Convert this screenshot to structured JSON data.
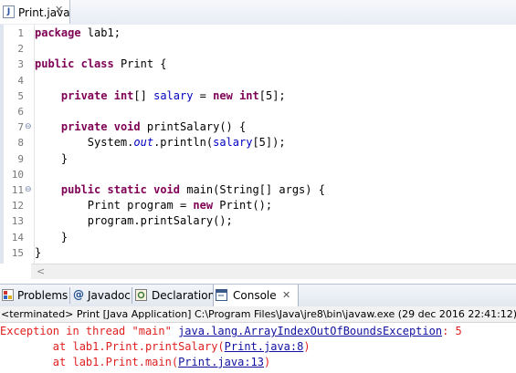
{
  "editor": {
    "tab_label": "Print.java",
    "tab_close": "✕",
    "file_icon_letter": "J",
    "lines": [
      {
        "num": "1",
        "fold": "",
        "parts": [
          {
            "t": "package",
            "c": "kw"
          },
          {
            "t": " lab1;",
            "c": ""
          }
        ]
      },
      {
        "num": "2",
        "fold": "",
        "parts": []
      },
      {
        "num": "3",
        "fold": "",
        "parts": [
          {
            "t": "public",
            "c": "kw"
          },
          {
            "t": " ",
            "c": ""
          },
          {
            "t": "class",
            "c": "kw"
          },
          {
            "t": " Print {",
            "c": ""
          }
        ]
      },
      {
        "num": "4",
        "fold": "",
        "parts": []
      },
      {
        "num": "5",
        "fold": "",
        "parts": [
          {
            "t": "    ",
            "c": ""
          },
          {
            "t": "private",
            "c": "kw"
          },
          {
            "t": " ",
            "c": ""
          },
          {
            "t": "int",
            "c": "kw"
          },
          {
            "t": "[] ",
            "c": ""
          },
          {
            "t": "salary",
            "c": "fld"
          },
          {
            "t": " = ",
            "c": ""
          },
          {
            "t": "new",
            "c": "kw"
          },
          {
            "t": " ",
            "c": ""
          },
          {
            "t": "int",
            "c": "kw"
          },
          {
            "t": "[5];",
            "c": ""
          }
        ]
      },
      {
        "num": "6",
        "fold": "",
        "parts": []
      },
      {
        "num": "7",
        "fold": "⊖",
        "parts": [
          {
            "t": "    ",
            "c": ""
          },
          {
            "t": "private",
            "c": "kw"
          },
          {
            "t": " ",
            "c": ""
          },
          {
            "t": "void",
            "c": "kw"
          },
          {
            "t": " printSalary() {",
            "c": ""
          }
        ]
      },
      {
        "num": "8",
        "fold": "",
        "parts": [
          {
            "t": "        System.",
            "c": ""
          },
          {
            "t": "out",
            "c": "sfld"
          },
          {
            "t": ".println(",
            "c": ""
          },
          {
            "t": "salary",
            "c": "fld"
          },
          {
            "t": "[5]);",
            "c": ""
          }
        ]
      },
      {
        "num": "9",
        "fold": "",
        "parts": [
          {
            "t": "    }",
            "c": ""
          }
        ]
      },
      {
        "num": "10",
        "fold": "",
        "parts": []
      },
      {
        "num": "11",
        "fold": "⊖",
        "parts": [
          {
            "t": "    ",
            "c": ""
          },
          {
            "t": "public",
            "c": "kw"
          },
          {
            "t": " ",
            "c": ""
          },
          {
            "t": "static",
            "c": "kw"
          },
          {
            "t": " ",
            "c": ""
          },
          {
            "t": "void",
            "c": "kw"
          },
          {
            "t": " main(String[] args) {",
            "c": ""
          }
        ]
      },
      {
        "num": "12",
        "fold": "",
        "parts": [
          {
            "t": "        Print program = ",
            "c": ""
          },
          {
            "t": "new",
            "c": "kw"
          },
          {
            "t": " Print();",
            "c": ""
          }
        ]
      },
      {
        "num": "13",
        "fold": "",
        "parts": [
          {
            "t": "        program.printSalary();",
            "c": ""
          }
        ]
      },
      {
        "num": "14",
        "fold": "",
        "parts": [
          {
            "t": "    }",
            "c": ""
          }
        ]
      },
      {
        "num": "15",
        "fold": "",
        "parts": [
          {
            "t": "}",
            "c": ""
          }
        ]
      }
    ],
    "scroll_left": "<"
  },
  "panel": {
    "tabs": [
      {
        "label": "Problems",
        "icon": "problems-icon"
      },
      {
        "label": "Javadoc",
        "icon": "javadoc-icon"
      },
      {
        "label": "Declaration",
        "icon": "declaration-icon"
      },
      {
        "label": "Console",
        "icon": "console-icon",
        "active": true
      }
    ],
    "console_close": "✕",
    "javadoc_glyph": "@",
    "status": "<terminated> Print [Java Application] C:\\Program Files\\Java\\jre8\\bin\\javaw.exe (29 dec 2016 22:41:12)"
  },
  "console": {
    "line1_prefix": "Exception in thread \"main\" ",
    "line1_link": "java.lang.ArrayIndexOutOfBoundsException",
    "line1_suffix": ": 5",
    "line2_prefix": "        at lab1.Print.printSalary(",
    "line2_link": "Print.java:8",
    "line2_suffix": ")",
    "line3_prefix": "        at lab1.Print.main(",
    "line3_link": "Print.java:13",
    "line3_suffix": ")"
  },
  "colors": {
    "keyword": "#7f0055",
    "field": "#0000c0",
    "error_text": "#e02020",
    "link": "#1010a0"
  }
}
